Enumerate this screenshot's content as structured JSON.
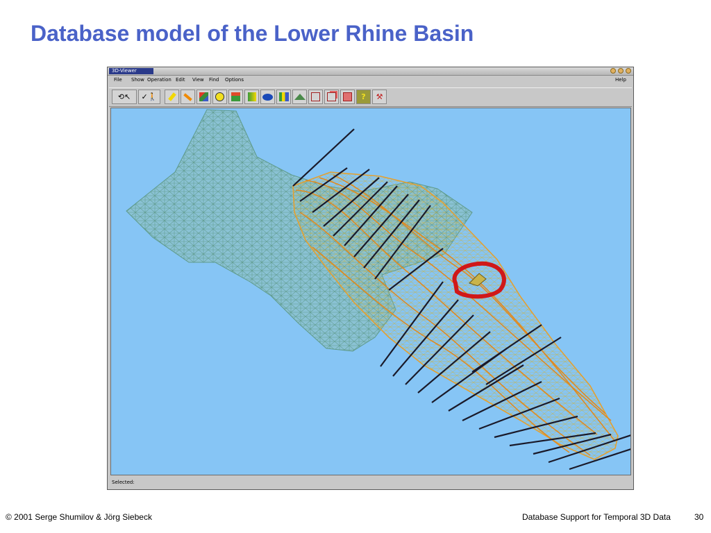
{
  "slide": {
    "title": "Database model of the Lower Rhine Basin",
    "footer_left": "© 2001 Serge Shumilov & Jörg Siebeck",
    "footer_right": "Database Support for Temporal 3D Data",
    "page_number": "30"
  },
  "window": {
    "title": "3D-Viewer",
    "menu": [
      "File",
      "Show",
      "Operation",
      "Edit",
      "View",
      "Find",
      "Options"
    ],
    "help": "Help",
    "status": "Selected:",
    "toolbar_icons": [
      "rotate-icon",
      "pointer-icon",
      "walk-icon",
      "plane-yellow-icon",
      "plane-orange-icon",
      "cube-color-icon",
      "clock-cube-icon",
      "clock-box-icon",
      "cross-section-icon",
      "blob-icon",
      "columns-icon",
      "terrain-icon",
      "box-outline-icon",
      "box-red-icon",
      "box-red-stack-icon",
      "question-icon",
      "tool-icon"
    ]
  },
  "colors": {
    "title": "#4a62c8",
    "viewport_bg": "#86c5f5",
    "mesh": "#5e9a8a",
    "layer": "#e4a030",
    "profile": "#1a1a2a",
    "highlight": "#d01818"
  }
}
